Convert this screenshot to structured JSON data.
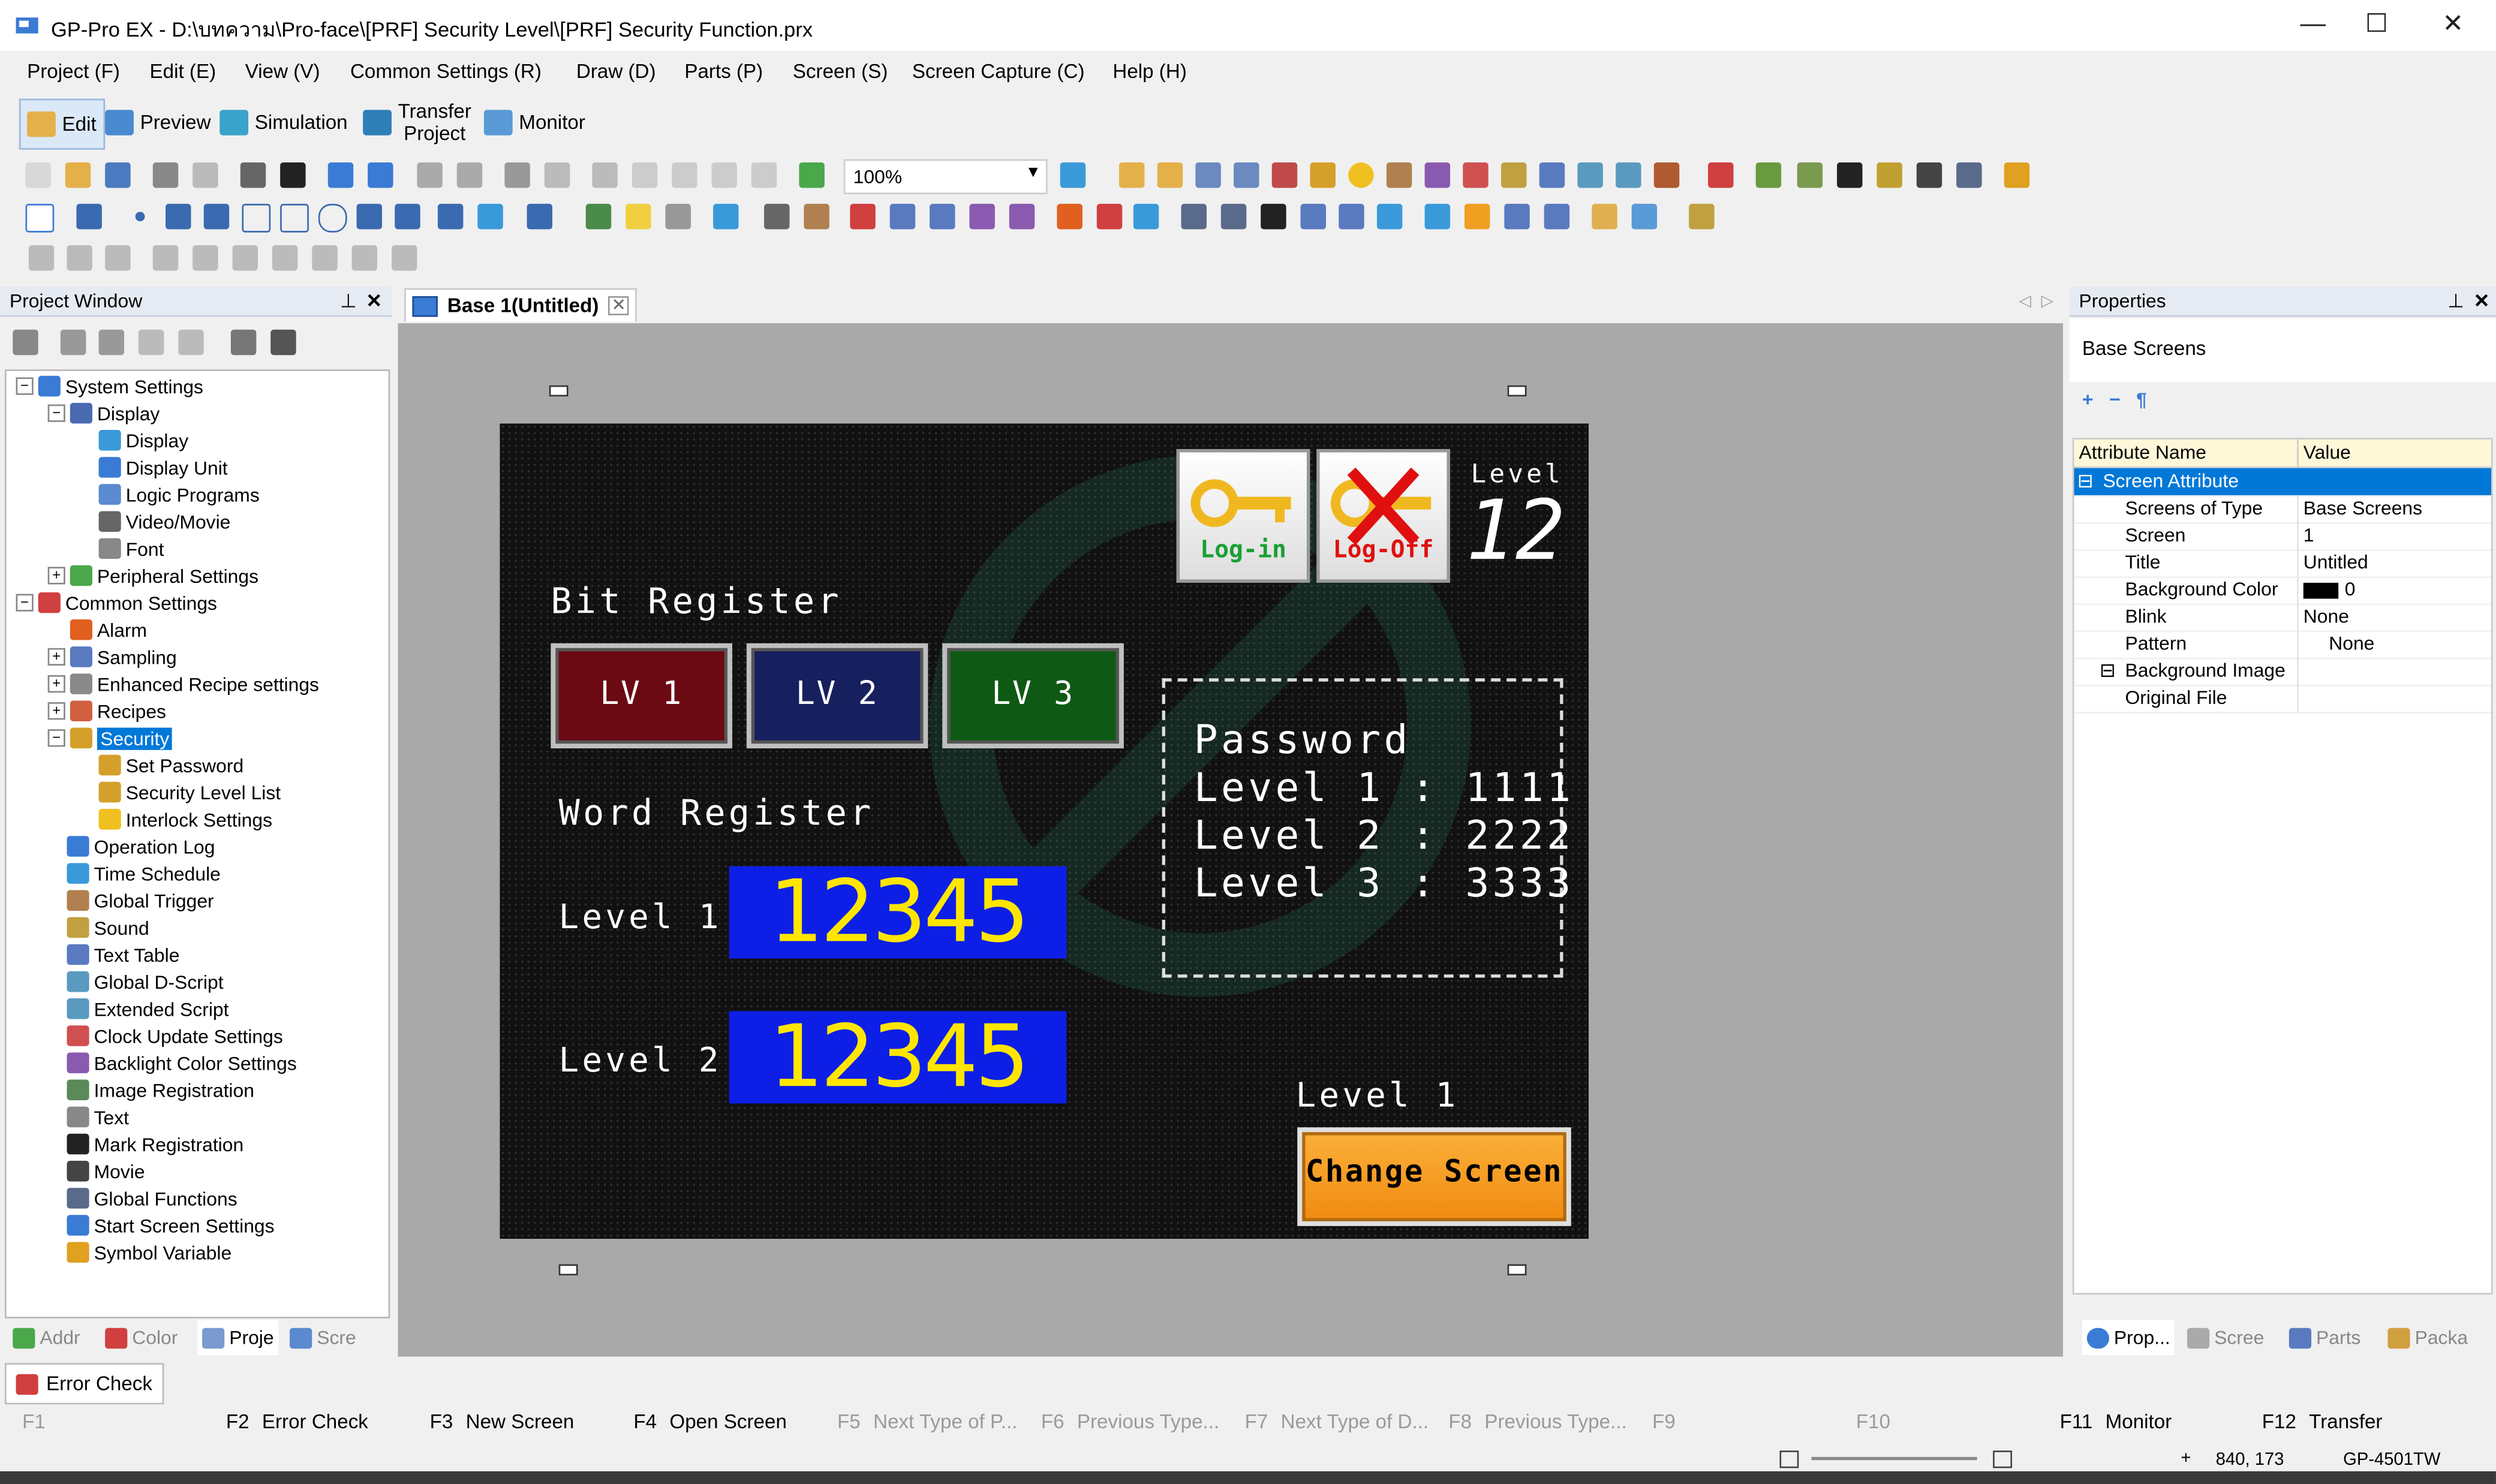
{
  "window": {
    "title": "GP-Pro EX - D:\\บทความ\\Pro-face\\[PRF] Security Level\\[PRF] Security Function.prx",
    "minimize": "—",
    "maximize": "☐",
    "close": "✕"
  },
  "menu": [
    "Project (F)",
    "Edit (E)",
    "View (V)",
    "Common Settings (R)",
    "Draw (D)",
    "Parts (P)",
    "Screen (S)",
    "Screen Capture (C)",
    "Help (H)"
  ],
  "modes": {
    "edit": "Edit",
    "preview": "Preview",
    "simulation": "Simulation",
    "transfer_line1": "Transfer",
    "transfer_line2": "Project",
    "monitor": "Monitor"
  },
  "zoom": "100%",
  "project_window": {
    "title": "Project Window",
    "tree": [
      {
        "label": "System Settings",
        "level": 0,
        "icon": "system-settings-icon",
        "exp": "−"
      },
      {
        "label": "Display",
        "level": 1,
        "icon": "folder-icon",
        "exp": "−"
      },
      {
        "label": "Display",
        "level": 2,
        "icon": "display-icon"
      },
      {
        "label": "Display Unit",
        "level": 2,
        "icon": "display-unit-icon"
      },
      {
        "label": "Logic Programs",
        "level": 2,
        "icon": "logic-icon"
      },
      {
        "label": "Video/Movie",
        "level": 2,
        "icon": "video-icon"
      },
      {
        "label": "Font",
        "level": 2,
        "icon": "font-icon"
      },
      {
        "label": "Peripheral Settings",
        "level": 1,
        "icon": "peripheral-icon",
        "exp": "+"
      },
      {
        "label": "Common Settings",
        "level": 0,
        "icon": "common-settings-icon",
        "exp": "−"
      },
      {
        "label": "Alarm",
        "level": 1,
        "icon": "alarm-icon",
        "exp": ""
      },
      {
        "label": "Sampling",
        "level": 1,
        "icon": "sampling-icon",
        "exp": "+"
      },
      {
        "label": "Enhanced Recipe settings",
        "level": 1,
        "icon": "recipe-icon",
        "exp": "+"
      },
      {
        "label": "Recipes",
        "level": 1,
        "icon": "recipes-icon",
        "exp": "+"
      },
      {
        "label": "Security",
        "level": 1,
        "icon": "key-icon",
        "exp": "−",
        "selected": true
      },
      {
        "label": "Set Password",
        "level": 2,
        "icon": "key-icon"
      },
      {
        "label": "Security Level List",
        "level": 2,
        "icon": "key-icon"
      },
      {
        "label": "Interlock Settings",
        "level": 2,
        "icon": "interlock-icon"
      },
      {
        "label": "Operation Log",
        "level": 1,
        "icon": "operation-log-icon"
      },
      {
        "label": "Time Schedule",
        "level": 1,
        "icon": "clock-icon"
      },
      {
        "label": "Global Trigger",
        "level": 1,
        "icon": "trigger-icon"
      },
      {
        "label": "Sound",
        "level": 1,
        "icon": "sound-icon"
      },
      {
        "label": "Text Table",
        "level": 1,
        "icon": "text-table-icon"
      },
      {
        "label": "Global D-Script",
        "level": 1,
        "icon": "script-icon"
      },
      {
        "label": "Extended Script",
        "level": 1,
        "icon": "script-icon"
      },
      {
        "label": "Clock Update Settings",
        "level": 1,
        "icon": "clock-update-icon"
      },
      {
        "label": "Backlight Color Settings",
        "level": 1,
        "icon": "backlight-icon"
      },
      {
        "label": "Image Registration",
        "level": 1,
        "icon": "image-icon"
      },
      {
        "label": "Text",
        "level": 1,
        "icon": "text-icon"
      },
      {
        "label": "Mark Registration",
        "level": 1,
        "icon": "mark-icon"
      },
      {
        "label": "Movie",
        "level": 1,
        "icon": "movie-icon"
      },
      {
        "label": "Global Functions",
        "level": 1,
        "icon": "functions-icon"
      },
      {
        "label": "Start Screen Settings",
        "level": 1,
        "icon": "start-screen-icon"
      },
      {
        "label": "Symbol Variable",
        "level": 1,
        "icon": "symbol-icon"
      }
    ],
    "bottom_tabs": [
      "Addr",
      "Color",
      "Proje",
      "Scre"
    ]
  },
  "editor": {
    "tab_title": "Base 1(Untitled)",
    "screen": {
      "bit_register": "Bit Register",
      "lv1": "LV 1",
      "lv2": "LV 2",
      "lv3": "LV 3",
      "word_register": "Word Register",
      "level1_label": "Level 1",
      "level2_label": "Level 2",
      "value1": "12345",
      "value2": "12345",
      "login": "Log-in",
      "logoff": "Log-Off",
      "level_title": "Level",
      "level_value": "12",
      "password_title": "Password",
      "pw_lines": [
        "Level 1 : 1111",
        "Level 2 : 2222",
        "Level 3 : 3333"
      ],
      "level_bottom": "Level 1",
      "change_screen": "Change Screen"
    },
    "colors": {
      "lv1": "#6b0a12",
      "lv2": "#17205e",
      "lv3": "#0e5a14",
      "value_bg": "#0d1fe6",
      "value_fg": "#ffe600",
      "change_btn": "#f79b1e"
    }
  },
  "properties": {
    "title": "Properties",
    "subtitle": "Base Screens",
    "col_name": "Attribute Name",
    "col_value": "Value",
    "rows": [
      {
        "name": "Screen Attribute",
        "value": "",
        "header": true
      },
      {
        "name": "Screens of Type",
        "value": "Base Screens"
      },
      {
        "name": "Screen",
        "value": "1"
      },
      {
        "name": "Title",
        "value": "Untitled"
      },
      {
        "name": "Background Color",
        "value": "0",
        "swatch": "#000000"
      },
      {
        "name": "Blink",
        "value": "None"
      },
      {
        "name": "Pattern",
        "value": "None"
      },
      {
        "name": "Background Image",
        "value": "",
        "sub": true
      },
      {
        "name": "Original File",
        "value": ""
      }
    ],
    "bottom_tabs": [
      "Prop...",
      "Scree",
      "Parts",
      "Packa"
    ]
  },
  "error_check_tab": "Error Check",
  "fkeys": [
    {
      "key": "F1",
      "label": "",
      "enabled": false
    },
    {
      "key": "F2",
      "label": "Error Check",
      "enabled": true
    },
    {
      "key": "F3",
      "label": "New Screen",
      "enabled": true
    },
    {
      "key": "F4",
      "label": "Open Screen",
      "enabled": true
    },
    {
      "key": "F5",
      "label": "Next Type of P...",
      "enabled": false
    },
    {
      "key": "F6",
      "label": "Previous  Type...",
      "enabled": false
    },
    {
      "key": "F7",
      "label": "Next Type of D...",
      "enabled": false
    },
    {
      "key": "F8",
      "label": "Previous  Type...",
      "enabled": false
    },
    {
      "key": "F9",
      "label": "",
      "enabled": false
    },
    {
      "key": "F10",
      "label": "",
      "enabled": false
    },
    {
      "key": "F11",
      "label": "Monitor",
      "enabled": true
    },
    {
      "key": "F12",
      "label": "Transfer",
      "enabled": true
    }
  ],
  "statusbar": {
    "coords": "840, 173",
    "model": "GP-4501TW"
  }
}
